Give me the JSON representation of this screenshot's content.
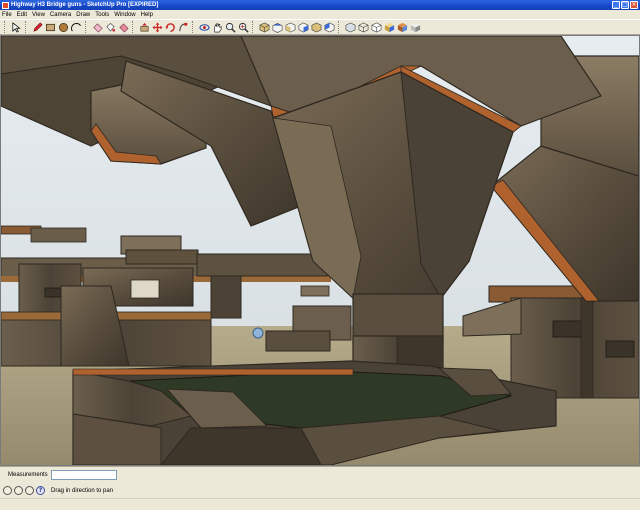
{
  "window": {
    "title": "Highway H3 Bridge guns - SketchUp Pro [EXPIRED]",
    "controls": [
      "_",
      "□",
      "×"
    ]
  },
  "menu": [
    "File",
    "Edit",
    "View",
    "Camera",
    "Draw",
    "Tools",
    "Window",
    "Help"
  ],
  "toolbar": {
    "groups": [
      [
        "select-arrow-icon"
      ],
      [
        "pencil-icon",
        "rectangle-icon",
        "circle-icon",
        "arc-icon"
      ],
      [
        "eraser-icon",
        "paint-bucket-icon",
        "eraser-alt-icon"
      ],
      [
        "push-pull-icon",
        "move-icon",
        "rotate-icon",
        "follow-me-icon"
      ],
      [
        "orbit-icon",
        "pan-hand-icon",
        "zoom-icon",
        "zoom-extents-icon"
      ],
      [
        "iso-view-icon",
        "top-view-icon",
        "front-view-icon",
        "right-view-icon",
        "back-view-icon",
        "left-view-icon"
      ],
      [
        "xray-icon",
        "wireframe-icon",
        "hidden-line-icon",
        "shaded-icon",
        "textured-icon",
        "monochrome-icon"
      ]
    ]
  },
  "measurements": {
    "label": "Measurements",
    "value": ""
  },
  "status": {
    "hint": "Drag in direction to pan",
    "help_glyph": "?"
  },
  "colors": {
    "titlebar": "#1747c8",
    "chrome": "#ece9d8",
    "sky": "#dfe6ea",
    "ground": "#a89f82",
    "stone_dark": "#4a4236",
    "stone_mid": "#6b5e4c",
    "rust": "#b0622e"
  }
}
